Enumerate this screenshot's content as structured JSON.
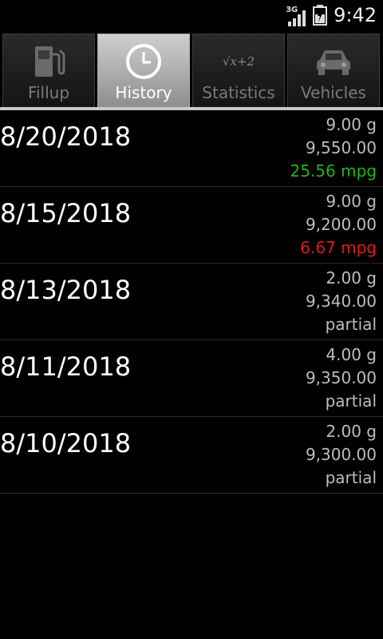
{
  "status_bar": {
    "network": "3G",
    "time": "9:42"
  },
  "tabs": [
    {
      "label": "Fillup",
      "icon": "fuel-pump-icon",
      "active": false
    },
    {
      "label": "History",
      "icon": "clock-icon",
      "active": true
    },
    {
      "label": "Statistics",
      "icon": "sqrt-formula-icon",
      "active": false,
      "icon_text": "√x+2"
    },
    {
      "label": "Vehicles",
      "icon": "car-icon",
      "active": false
    }
  ],
  "history": [
    {
      "date": "8/20/2018",
      "gallons": "9.00 g",
      "odometer": "9,550.00",
      "efficiency": "25.56 mpg",
      "efficiency_color": "#1eb41e"
    },
    {
      "date": "8/15/2018",
      "gallons": "9.00 g",
      "odometer": "9,200.00",
      "efficiency": "6.67 mpg",
      "efficiency_color": "#e01a1a"
    },
    {
      "date": "8/13/2018",
      "gallons": "2.00 g",
      "odometer": "9,340.00",
      "efficiency": "partial"
    },
    {
      "date": "8/11/2018",
      "gallons": "4.00 g",
      "odometer": "9,350.00",
      "efficiency": "partial"
    },
    {
      "date": "8/10/2018",
      "gallons": "2.00 g",
      "odometer": "9,300.00",
      "efficiency": "partial"
    }
  ]
}
